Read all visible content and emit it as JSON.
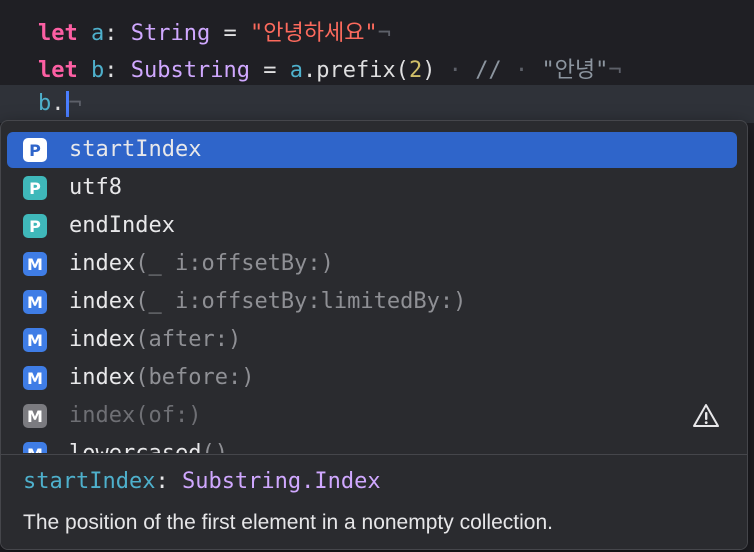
{
  "editor": {
    "lines": [
      {
        "tokens": [
          {
            "t": "let",
            "c": "kw"
          },
          {
            "t": " ",
            "c": "plain"
          },
          {
            "t": "a",
            "c": "id"
          },
          {
            "t": ": ",
            "c": "plain"
          },
          {
            "t": "String",
            "c": "type"
          },
          {
            "t": " ",
            "c": "plain"
          },
          {
            "t": "=",
            "c": "plain"
          },
          {
            "t": " ",
            "c": "plain"
          },
          {
            "t": "\"안녕하세요\"",
            "c": "str"
          },
          {
            "t": "¬",
            "c": "ws"
          }
        ]
      },
      {
        "tokens": [
          {
            "t": "let",
            "c": "kw"
          },
          {
            "t": " ",
            "c": "plain"
          },
          {
            "t": "b",
            "c": "id"
          },
          {
            "t": ": ",
            "c": "plain"
          },
          {
            "t": "Substring",
            "c": "type"
          },
          {
            "t": " ",
            "c": "plain"
          },
          {
            "t": "=",
            "c": "plain"
          },
          {
            "t": " ",
            "c": "plain"
          },
          {
            "t": "a",
            "c": "id"
          },
          {
            "t": ".prefix(",
            "c": "plain"
          },
          {
            "t": "2",
            "c": "num"
          },
          {
            "t": ")",
            "c": "plain"
          },
          {
            "t": " · ",
            "c": "ws"
          },
          {
            "t": "//",
            "c": "cmt"
          },
          {
            "t": " · ",
            "c": "ws"
          },
          {
            "t": "\"안녕\"",
            "c": "cmt"
          },
          {
            "t": "¬",
            "c": "ws"
          }
        ]
      },
      {
        "tokens": [
          {
            "t": "b",
            "c": "id"
          },
          {
            "t": ".",
            "c": "plain"
          }
        ],
        "cursor": true,
        "tail": "¬"
      }
    ]
  },
  "completions": [
    {
      "kind": "P",
      "name": "startIndex",
      "sig": "",
      "selected": true,
      "dim": false,
      "warning": false
    },
    {
      "kind": "P",
      "name": "utf8",
      "sig": "",
      "selected": false,
      "dim": false,
      "warning": false
    },
    {
      "kind": "P",
      "name": "endIndex",
      "sig": "",
      "selected": false,
      "dim": false,
      "warning": false
    },
    {
      "kind": "M",
      "name": "index",
      "sig": "(_ i:offsetBy:)",
      "selected": false,
      "dim": false,
      "warning": false
    },
    {
      "kind": "M",
      "name": "index",
      "sig": "(_ i:offsetBy:limitedBy:)",
      "selected": false,
      "dim": false,
      "warning": false
    },
    {
      "kind": "M",
      "name": "index",
      "sig": "(after:)",
      "selected": false,
      "dim": false,
      "warning": false
    },
    {
      "kind": "M",
      "name": "index",
      "sig": "(before:)",
      "selected": false,
      "dim": false,
      "warning": false
    },
    {
      "kind": "M",
      "name": "index",
      "sig": "(of:)",
      "selected": false,
      "dim": true,
      "warning": true
    },
    {
      "kind": "M",
      "name": "lowercased",
      "sig": "()",
      "selected": false,
      "dim": false,
      "warning": false
    }
  ],
  "detail": {
    "name": "startIndex",
    "colon": ": ",
    "type": "Substring.Index",
    "description": "The position of the first element in a nonempty collection."
  },
  "icons": {
    "warning": "warning-triangle-icon",
    "property": "property-badge-icon",
    "method": "method-badge-icon"
  },
  "colors": {
    "selection": "#2f65ca",
    "property_badge": "#3fb8ba",
    "method_badge": "#3f7de6",
    "keyword": "#fc5fa3",
    "string": "#fc6a5d",
    "type": "#d0a8ff"
  }
}
